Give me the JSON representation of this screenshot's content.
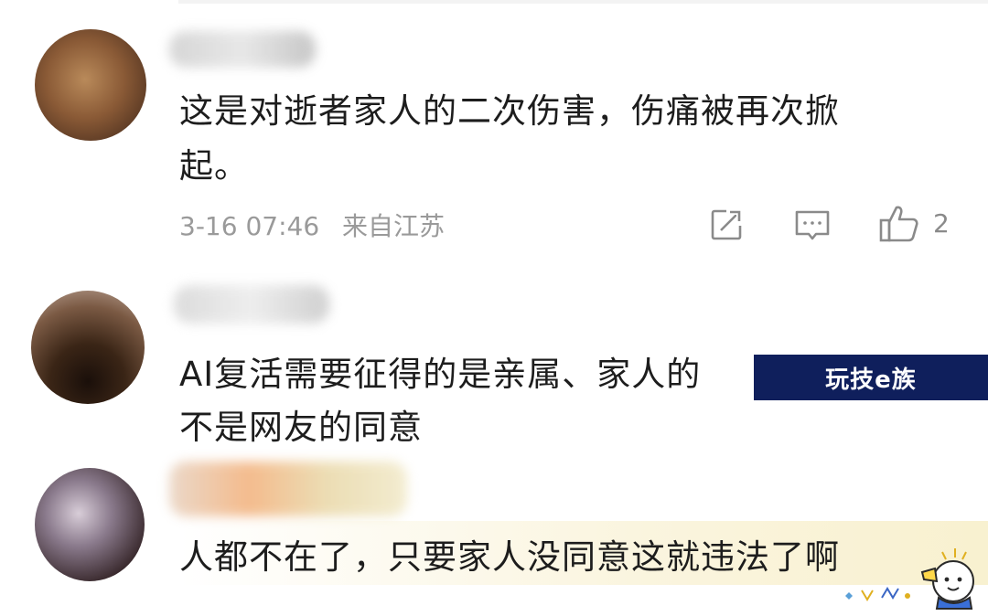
{
  "comments": [
    {
      "text_line1": "这是对逝者家人的二次伤害，伤痛被再次掀",
      "text_line2": "起。",
      "date": "3-16 07:46",
      "location": "来自江苏",
      "likes": "2"
    },
    {
      "text_line1": "AI复活需要征得的是亲属、家人的",
      "text_line2": "不是网友的同意"
    },
    {
      "text_line1": "人都不在了，只要家人没同意这就违法了啊"
    }
  ],
  "watermark": "玩技e族",
  "icons": {
    "share": "share-icon",
    "comment": "comment-icon",
    "like": "thumbs-up-icon"
  },
  "colors": {
    "text": "#1d1d1d",
    "meta": "#9a9a9a",
    "watermark_bg": "#0f1f5c"
  }
}
